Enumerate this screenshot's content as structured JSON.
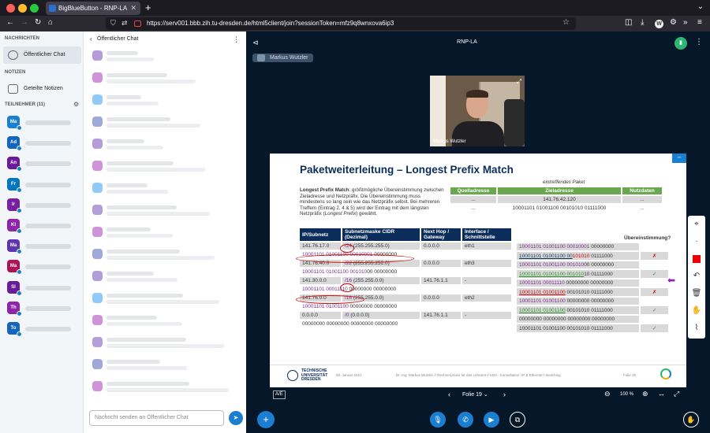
{
  "browser": {
    "tab_title": "BigBlueButton - RNP-LA",
    "new_tab": "+",
    "url": "https://serv001.bbb.zih.tu-dresden.de/html5client/join?sessionToken=mfz9q8wnxova6ip3"
  },
  "sidebar": {
    "messages_heading": "NACHRICHTEN",
    "public_chat": "Öffentlicher Chat",
    "notes_heading": "NOTIZEN",
    "shared_notes": "Geteilte Notizen",
    "participants_heading": "TEILNEHMER (11)",
    "participants": [
      {
        "initials": "Ma",
        "color": "#1b7fd1"
      },
      {
        "initials": "Ad",
        "color": "#1565c0"
      },
      {
        "initials": "An",
        "color": "#6a1b9a"
      },
      {
        "initials": "Fr",
        "color": "#0277bd"
      },
      {
        "initials": "Ir",
        "color": "#7b1fa2"
      },
      {
        "initials": "Kl",
        "color": "#8e24aa"
      },
      {
        "initials": "Ma",
        "color": "#5e35b1"
      },
      {
        "initials": "Ma",
        "color": "#ad1457"
      },
      {
        "initials": "Sl",
        "color": "#6a1b9a"
      },
      {
        "initials": "Th",
        "color": "#8e24aa"
      },
      {
        "initials": "To",
        "color": "#1565c0"
      }
    ]
  },
  "chat": {
    "title": "Öffentlicher Chat",
    "input_placeholder": "Nachricht senden an Öffentlicher Chat"
  },
  "meeting": {
    "title": "RNP-LA",
    "presenter": "Markus Wutzler",
    "video_label": "Markus Wutzler"
  },
  "slide": {
    "title": "Paketweiterleitung – Longest Prefix Match",
    "intro_bold": "Longest Prefix Match",
    "intro_text": ": größtmögliche Übereinstimmung zwischen Zieladresse und Netzpräfix. Die Übereinstimmung muss mindestens so lang sein wie das Netzpräfix selbst. Bei mehreren Treffern (Eintrag 2, 4 & 5) wird der Eintrag mit dem längsten Netzpräfix (",
    "intro_italic": "Longest Prefix",
    "intro_end": ") gewählt.",
    "packet_caption": "eintreffendes Paket",
    "packet_headers": [
      "Quelladresse",
      "Zieladresse",
      "Nutzdaten"
    ],
    "packet_row1": [
      "...",
      "141.76.42.120",
      "..."
    ],
    "packet_row2": [
      "...",
      "10001101 01001100 00101010 01111000",
      "..."
    ],
    "route_headers": [
      "IP/Subnetz",
      "Subnetzmaske CIDR (Dezimal)",
      "Next Hop / Gateway",
      "Interface / Schnittstelle"
    ],
    "match_header": "Übereinstimmung?",
    "routes": [
      {
        "ip": "141.76.17.0",
        "cidr": "/24",
        "mask": "(255.255.255.0)",
        "hop": "0.0.0.0",
        "iface": "eth1",
        "bin_a": "10001101 01001100 00010001",
        "bin_b": " 00000000",
        "cmp_a": "10001101 01001100 00010001",
        "cmp_b": " 00000000",
        "cmp2_a": "10001101 01001100 00",
        "cmp2_red": "101010",
        "cmp2_b": " 01111000",
        "result": "✗"
      },
      {
        "ip": "141.76.40.0",
        "cidr": "/22",
        "mask": "(255.255.252.0)",
        "hop": "0.0.0.0",
        "iface": "eth3",
        "bin_a": "10001101 01001100 001010",
        "bin_b": "00 00000000",
        "cmp_a": "10001101 01001100 001010",
        "cmp_b": "00 00000000",
        "cmp2_a": "10001101 01001100 001010",
        "cmp2_b": "10 01111000",
        "result": "✓"
      },
      {
        "ip": "141.30.0.0",
        "cidr": "/16",
        "mask": "(255.255.0.0)",
        "hop": "141.76.1.1",
        "iface": "-",
        "bin_a": "10001101 00011110",
        "bin_b": " 00000000 00000000",
        "cmp_a": "10001101 00011110",
        "cmp_b": " 00000000 00000000",
        "cmp2_a": "10001101 01001100",
        "cmp2_b": " 00101010 01111000",
        "result": "✗"
      },
      {
        "ip": "141.76.0.0",
        "cidr": "/16",
        "mask": "(255.255.0.0)",
        "hop": "0.0.0.0",
        "iface": "eth2",
        "bin_a": "10001101 01001100",
        "bin_b": " 00000000 00000000",
        "cmp_a": "10001101 01001100",
        "cmp_b": " 00000000 00000000",
        "cmp2_a": "10001101 01001100",
        "cmp2_b": " 00101010 01111000",
        "result": "✓"
      },
      {
        "ip": "0.0.0.0",
        "cidr": "/0",
        "mask": "(0.0.0.0)",
        "hop": "141.76.1.1",
        "iface": "-",
        "bin_a": "",
        "bin_b": "00000000 00000000 00000000 00000000",
        "cmp_a": "",
        "cmp_b": "00000000 00000000 00000000 00000000",
        "cmp2_a": "",
        "cmp2_b": "10001101 01001100 00101010 01111000",
        "result": "✓"
      }
    ],
    "footer_uni": "TECHNISCHE UNIVERSITÄT DRESDEN",
    "footer_date": "20. Januar 2021",
    "footer_text": "Dr.-Ing. Markus Wutzler // Rechnerpraxis für das Lehramt // KD3 - Konsultation: IP & Ethernet / Switching",
    "footer_page": "Folie 19"
  },
  "slide_controls": {
    "ae_label": "A/E",
    "slide_select": "Folie 19",
    "zoom": "100 %"
  }
}
